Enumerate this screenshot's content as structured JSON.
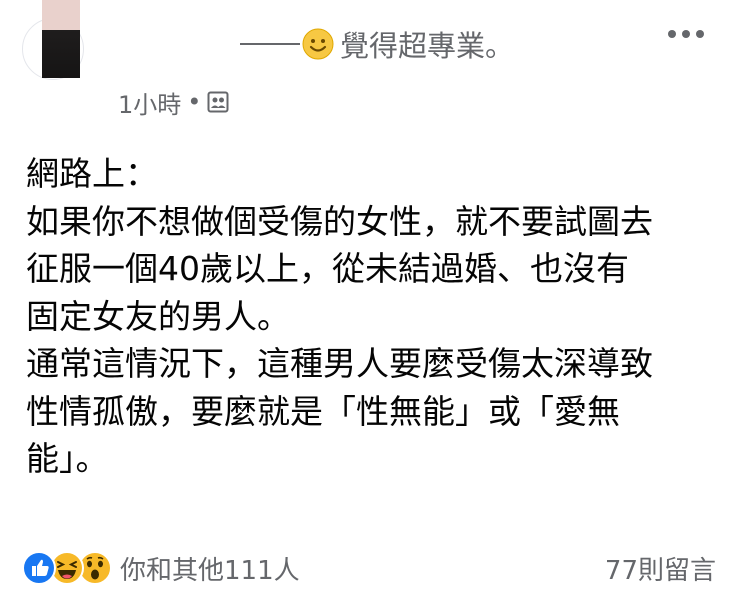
{
  "header": {
    "author_name": "覺得超專業。",
    "timestamp": "1小時",
    "separator": "•",
    "audience_icon": "friends-icon",
    "more_icon": "more-icon"
  },
  "post": {
    "lines": [
      "網路上：",
      "如果你不想做個受傷的女性，就不要試圖去",
      "征服一個40歲以上，從未結過婚、也沒有",
      "固定女友的男人。",
      "通常這情況下，這種男人要麼受傷太深導致",
      "性情孤傲，要麼就是「性無能」或「愛無",
      "能」。"
    ]
  },
  "footer": {
    "reaction_icons": [
      "like-icon",
      "haha-icon",
      "wow-icon"
    ],
    "reaction_text": "你和其他111人",
    "comments_text": "77則留言"
  },
  "colors": {
    "text": "#050505",
    "secondary": "#65676b",
    "like_blue": "#1877f2",
    "emoji_yellow": "#f7b928"
  }
}
